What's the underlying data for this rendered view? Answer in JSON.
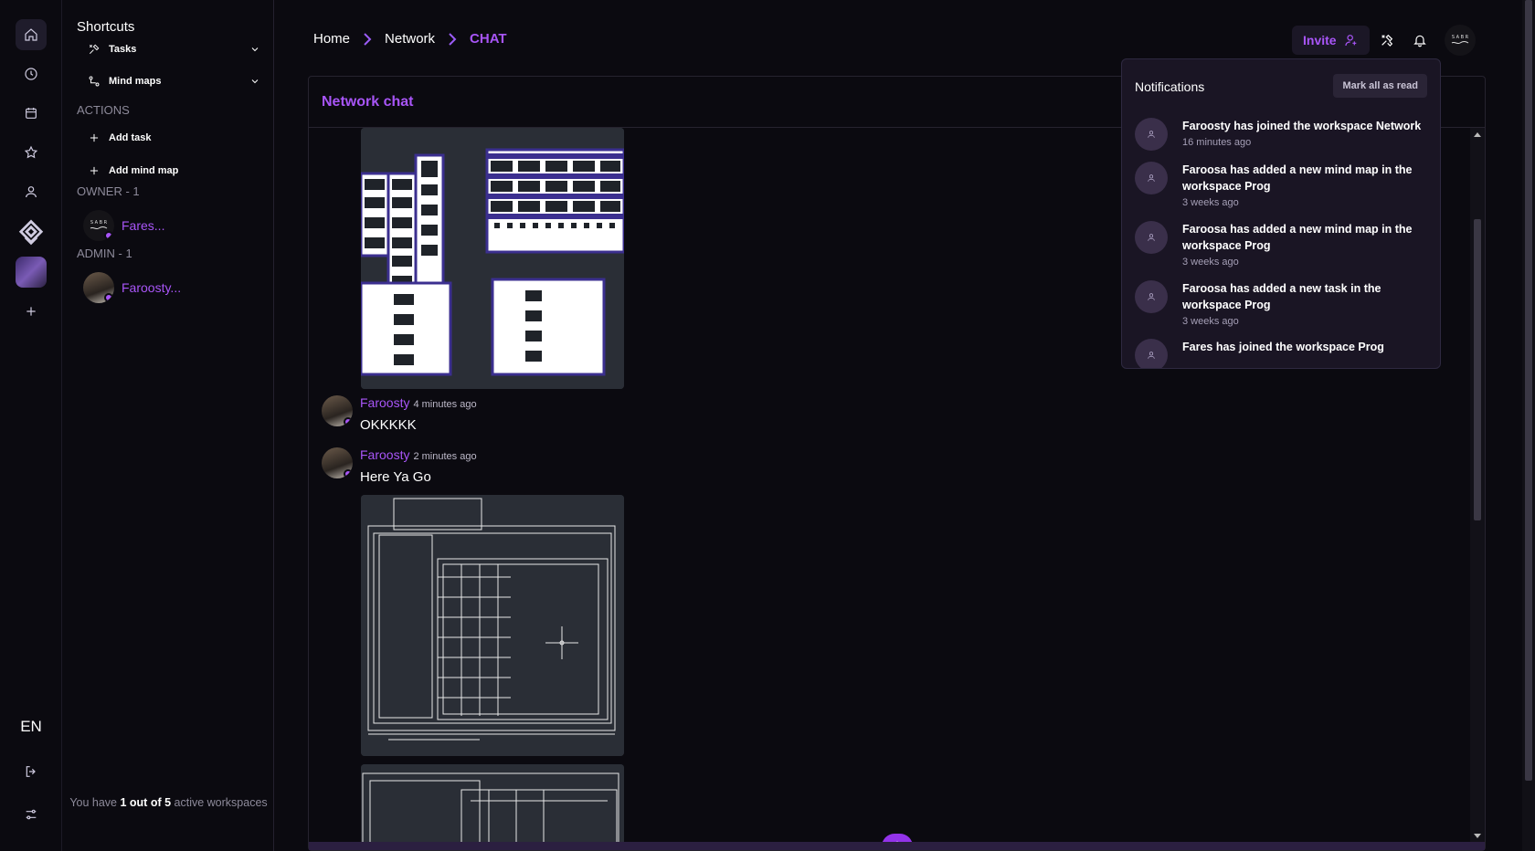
{
  "rail": {
    "language": "EN"
  },
  "sidebar": {
    "title": "Shortcuts",
    "shortcuts": [
      {
        "label": "Tasks",
        "icon": "tools-icon"
      },
      {
        "label": "Mind maps",
        "icon": "mindmap-icon"
      }
    ],
    "actions_title": "ACTIONS",
    "actions": [
      {
        "label": "Add task"
      },
      {
        "label": "Add mind map"
      }
    ],
    "owner_title": "OWNER - 1",
    "owner": {
      "name": "Fares..."
    },
    "admin_title": "ADMIN - 1",
    "admin": {
      "name": "Faroosty..."
    },
    "footer": {
      "prefix": "You have ",
      "active": "1",
      "mid": " out of ",
      "total": "5",
      "suffix": " active workspaces"
    }
  },
  "breadcrumb": {
    "items": [
      "Home",
      "Network"
    ],
    "current": "CHAT"
  },
  "header": {
    "invite_label": "Invite"
  },
  "chat": {
    "title": "Network chat",
    "messages": [
      {
        "author": "Faroosty",
        "time": "4 minutes ago",
        "text": "OKKKKK"
      },
      {
        "author": "Faroosty",
        "time": "2 minutes ago",
        "text": "Here Ya Go"
      }
    ]
  },
  "notifications": {
    "title": "Notifications",
    "mark_all": "Mark all as read",
    "items": [
      {
        "who": "Faroosty",
        "text": " has joined the workspace Network",
        "time": "16 minutes ago"
      },
      {
        "who": "Faroosa",
        "text": " has added a new mind map in the workspace Prog",
        "time": "3 weeks ago"
      },
      {
        "who": "Faroosa",
        "text": " has added a new mind map in the workspace Prog",
        "time": "3 weeks ago"
      },
      {
        "who": "Faroosa",
        "text": " has added a new task in the workspace Prog",
        "time": "3 weeks ago"
      },
      {
        "who": "Fares",
        "text": " has joined the workspace Prog",
        "time": ""
      }
    ]
  },
  "colors": {
    "accent": "#a855f7",
    "background": "#0b0a10",
    "panel_border": "#26232f",
    "dropdown_bg": "#1a1524"
  }
}
